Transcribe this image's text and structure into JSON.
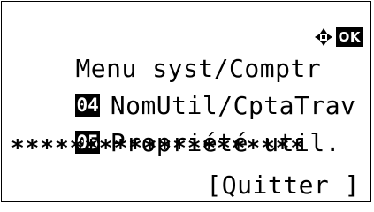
{
  "screen": {
    "title": "Menu syst/Comptr",
    "ok_label": "OK",
    "nav_icon": "four-way-arrows-icon",
    "items": [
      {
        "number": "04",
        "label": "NomUtil/CptaTrav"
      },
      {
        "number": "05",
        "label": "Propriété util."
      }
    ],
    "password_mask": "********************",
    "softkey_label": "[Quitter ]"
  }
}
